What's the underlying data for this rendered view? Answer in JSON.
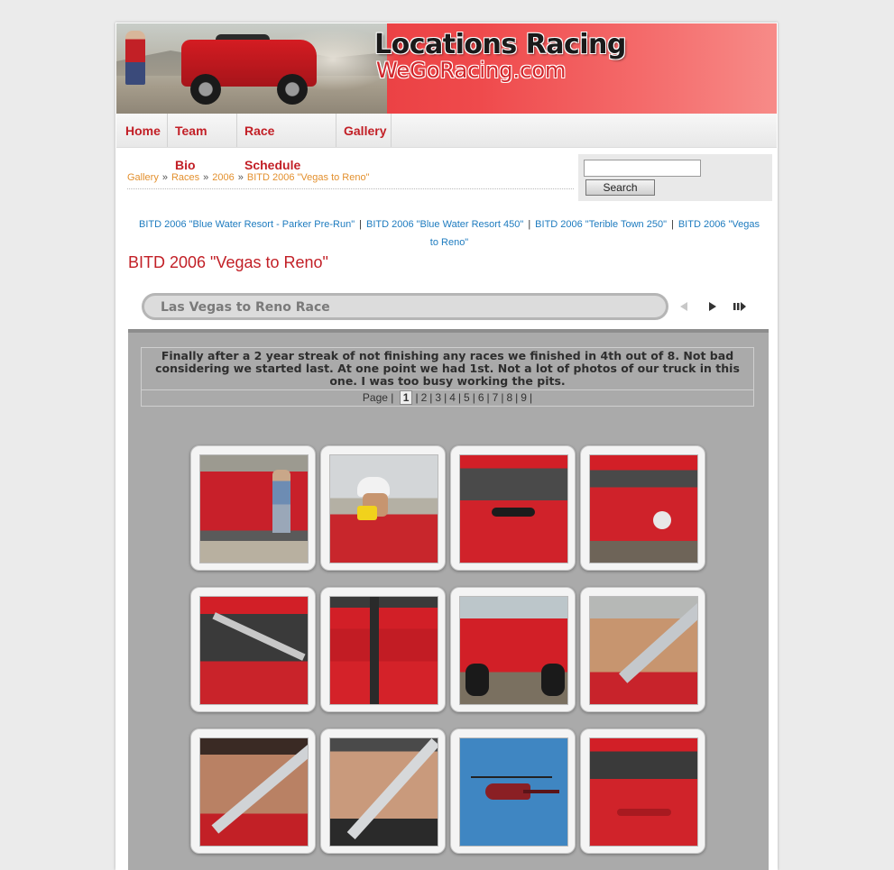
{
  "site": {
    "title": "Locations Racing",
    "subtitle": "WeGoRacing.com"
  },
  "nav": {
    "items": [
      {
        "label": "Home"
      },
      {
        "label": "Team Bio"
      },
      {
        "label": "Race Schedule"
      },
      {
        "label": "Gallery"
      }
    ]
  },
  "breadcrumb": {
    "items": [
      "Gallery",
      "Races",
      "2006",
      "BITD 2006 \"Vegas to Reno\""
    ],
    "separator": "»"
  },
  "search": {
    "value": "",
    "button_label": "Search"
  },
  "sub_albums": [
    "BITD 2006 \"Blue Water Resort - Parker Pre-Run\"",
    "BITD 2006 \"Blue Water Resort 450\"",
    "BITD 2006 \"Terible Town 250\"",
    "BITD 2006 \"Vegas to Reno\""
  ],
  "album": {
    "title": "BITD 2006 \"Vegas to Reno\""
  },
  "gallery": {
    "title": "Las Vegas to Reno Race",
    "description": "Finally after a 2 year streak of not finishing any races we finished in 4th out of 8. Not bad considering we started last. At one point we had 1st. Not a lot of photos of our truck in this one. I was too busy working the pits.",
    "pager_label": "Page",
    "pages": [
      "1",
      "2",
      "3",
      "4",
      "5",
      "6",
      "7",
      "8",
      "9"
    ],
    "current_page": "1",
    "thumbnails": [
      {
        "subject": "red race truck in pits with crew"
      },
      {
        "subject": "crew member in white cap"
      },
      {
        "subject": "red truck hood with driver"
      },
      {
        "subject": "red truck front grille"
      },
      {
        "subject": "driver inside cab"
      },
      {
        "subject": "red truck door"
      },
      {
        "subject": "red race truck front view"
      },
      {
        "subject": "driver with roll cage bar"
      },
      {
        "subject": "driver close-up"
      },
      {
        "subject": "driver with headset"
      },
      {
        "subject": "helicopter in blue sky"
      },
      {
        "subject": "red truck windshield"
      }
    ]
  },
  "colors": {
    "accent": "#c21f26",
    "breadcrumb_link": "#e3902e",
    "album_link": "#1d7bbf",
    "panel": "#aaaaaa"
  },
  "icons": [
    "search-icon",
    "previous-icon",
    "play-icon",
    "next-last-icon"
  ]
}
